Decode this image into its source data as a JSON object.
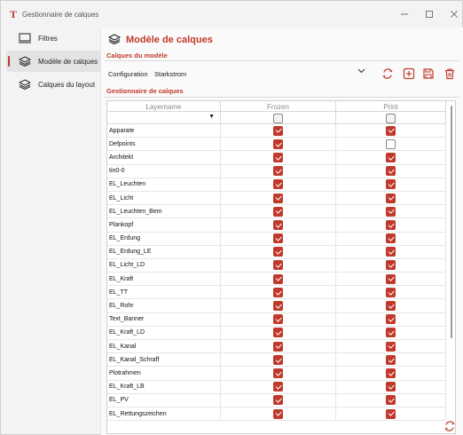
{
  "window": {
    "title": "Gestionnaire de calques"
  },
  "sidebar": {
    "items": [
      {
        "label": "Filtres",
        "icon": "monitor-icon",
        "active": false
      },
      {
        "label": "Modèle de calques",
        "icon": "layers-icon",
        "active": true
      },
      {
        "label": "Calques du layout",
        "icon": "layers-icon",
        "active": false
      }
    ]
  },
  "main": {
    "title": "Modèle de calques",
    "section_model": "Calques du modèle",
    "section_manager": "Gestionnaire de calques",
    "config_label": "Configuration",
    "config_value": "Starkstrom"
  },
  "grid": {
    "headers": {
      "name": "Layername",
      "frozen": "Frozen",
      "print": "Print"
    },
    "rows": [
      {
        "name": "Apparate",
        "frozen": true,
        "print": true
      },
      {
        "name": "Defpoints",
        "frozen": true,
        "print": false
      },
      {
        "name": "Architekt",
        "frozen": true,
        "print": true
      },
      {
        "name": "tin0-0",
        "frozen": true,
        "print": true
      },
      {
        "name": "EL_Leuchten",
        "frozen": true,
        "print": true
      },
      {
        "name": "EL_Licht",
        "frozen": true,
        "print": true
      },
      {
        "name": "EL_Leuchten_Bem",
        "frozen": true,
        "print": true
      },
      {
        "name": "Plankopf",
        "frozen": true,
        "print": true
      },
      {
        "name": "EL_Erdung",
        "frozen": true,
        "print": true
      },
      {
        "name": "EL_Erdung_LE",
        "frozen": true,
        "print": true
      },
      {
        "name": "EL_Licht_LD",
        "frozen": true,
        "print": true
      },
      {
        "name": "EL_Kraft",
        "frozen": true,
        "print": true
      },
      {
        "name": "EL_TT",
        "frozen": true,
        "print": true
      },
      {
        "name": "EL_Rohr",
        "frozen": true,
        "print": true
      },
      {
        "name": "Text_Banner",
        "frozen": true,
        "print": true
      },
      {
        "name": "EL_Kraft_LD",
        "frozen": true,
        "print": true
      },
      {
        "name": "EL_Kanal",
        "frozen": true,
        "print": true
      },
      {
        "name": "EL_Kanal_Schraff",
        "frozen": true,
        "print": true
      },
      {
        "name": "Plotrahmen",
        "frozen": true,
        "print": true
      },
      {
        "name": "EL_Kraft_LB",
        "frozen": true,
        "print": true
      },
      {
        "name": "EL_PV",
        "frozen": true,
        "print": true
      },
      {
        "name": "EL_Rettungszeichen",
        "frozen": true,
        "print": true
      }
    ]
  },
  "colors": {
    "accent": "#c0392b"
  }
}
